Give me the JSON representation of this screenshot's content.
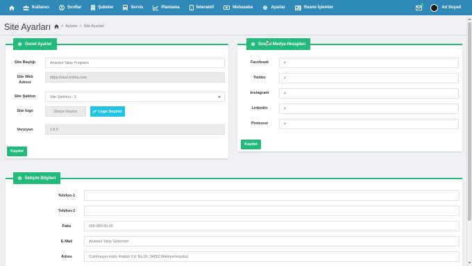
{
  "nav": {
    "items": [
      {
        "label": "Kullanıcı",
        "icon": "users-icon"
      },
      {
        "label": "Sınıflar",
        "icon": "user-circle-icon"
      },
      {
        "label": "Şubeler",
        "icon": "building-icon"
      },
      {
        "label": "Servis",
        "icon": "bus-icon"
      },
      {
        "label": "Planlama",
        "icon": "chart-line-icon"
      },
      {
        "label": "İnteraktif",
        "icon": "tablet-icon"
      },
      {
        "label": "Muhasebe",
        "icon": "money-icon"
      },
      {
        "label": "Ayarlar",
        "icon": "gear-icon"
      },
      {
        "label": "Resmi İşlemler",
        "icon": "card-icon"
      }
    ],
    "user_name": "Ad Soyad"
  },
  "page": {
    "title": "Site Ayarları",
    "breadcrumb": [
      "Ayarlar",
      "Site Ayarları"
    ]
  },
  "general": {
    "header": "Genel Ayarlar",
    "site_title_label": "Site Başlığı",
    "site_title_value": "Anaokul Takip Programı",
    "site_address_label_1": "Site Web",
    "site_address_label_2": "Adresi",
    "site_address_value": "https://okul.entirla.com",
    "template_label": "Site Şablon",
    "template_value": "Site Şablonu - 2",
    "logo_label": "Site logo",
    "file_placeholder": "Dosya Seçiniz",
    "logo_button": "Logo Seçiniz",
    "version_label": "Versiyon",
    "version_value": "1.5.0",
    "save_label": "Kaydet"
  },
  "social": {
    "header": "Sosyal Medya Hesapları",
    "fields": [
      {
        "label": "Facebook",
        "value": "#"
      },
      {
        "label": "Twitter",
        "value": "#"
      },
      {
        "label": "Instagram",
        "value": "#"
      },
      {
        "label": "Linkedin",
        "value": "#"
      },
      {
        "label": "Pinterest",
        "value": "#"
      }
    ],
    "save_label": "Kaydet"
  },
  "contact": {
    "header": "İletişim Bilgileri",
    "fields": [
      {
        "label": "Telefon-1",
        "value": ""
      },
      {
        "label": "Telefon-2",
        "value": ""
      },
      {
        "label": "Faks",
        "value": "000-000-00-00"
      },
      {
        "label": "E-Mail",
        "value": "Anaokul Takip Sistemleri"
      },
      {
        "label": "Adres",
        "value": "Cumhuriyet mahi, Atatürk Cd. No:26, 34852 Maltepe/İstanbul"
      }
    ]
  },
  "colors": {
    "navbar": "#2f89b8",
    "accent": "#21ba79",
    "info": "#22c3e3"
  }
}
